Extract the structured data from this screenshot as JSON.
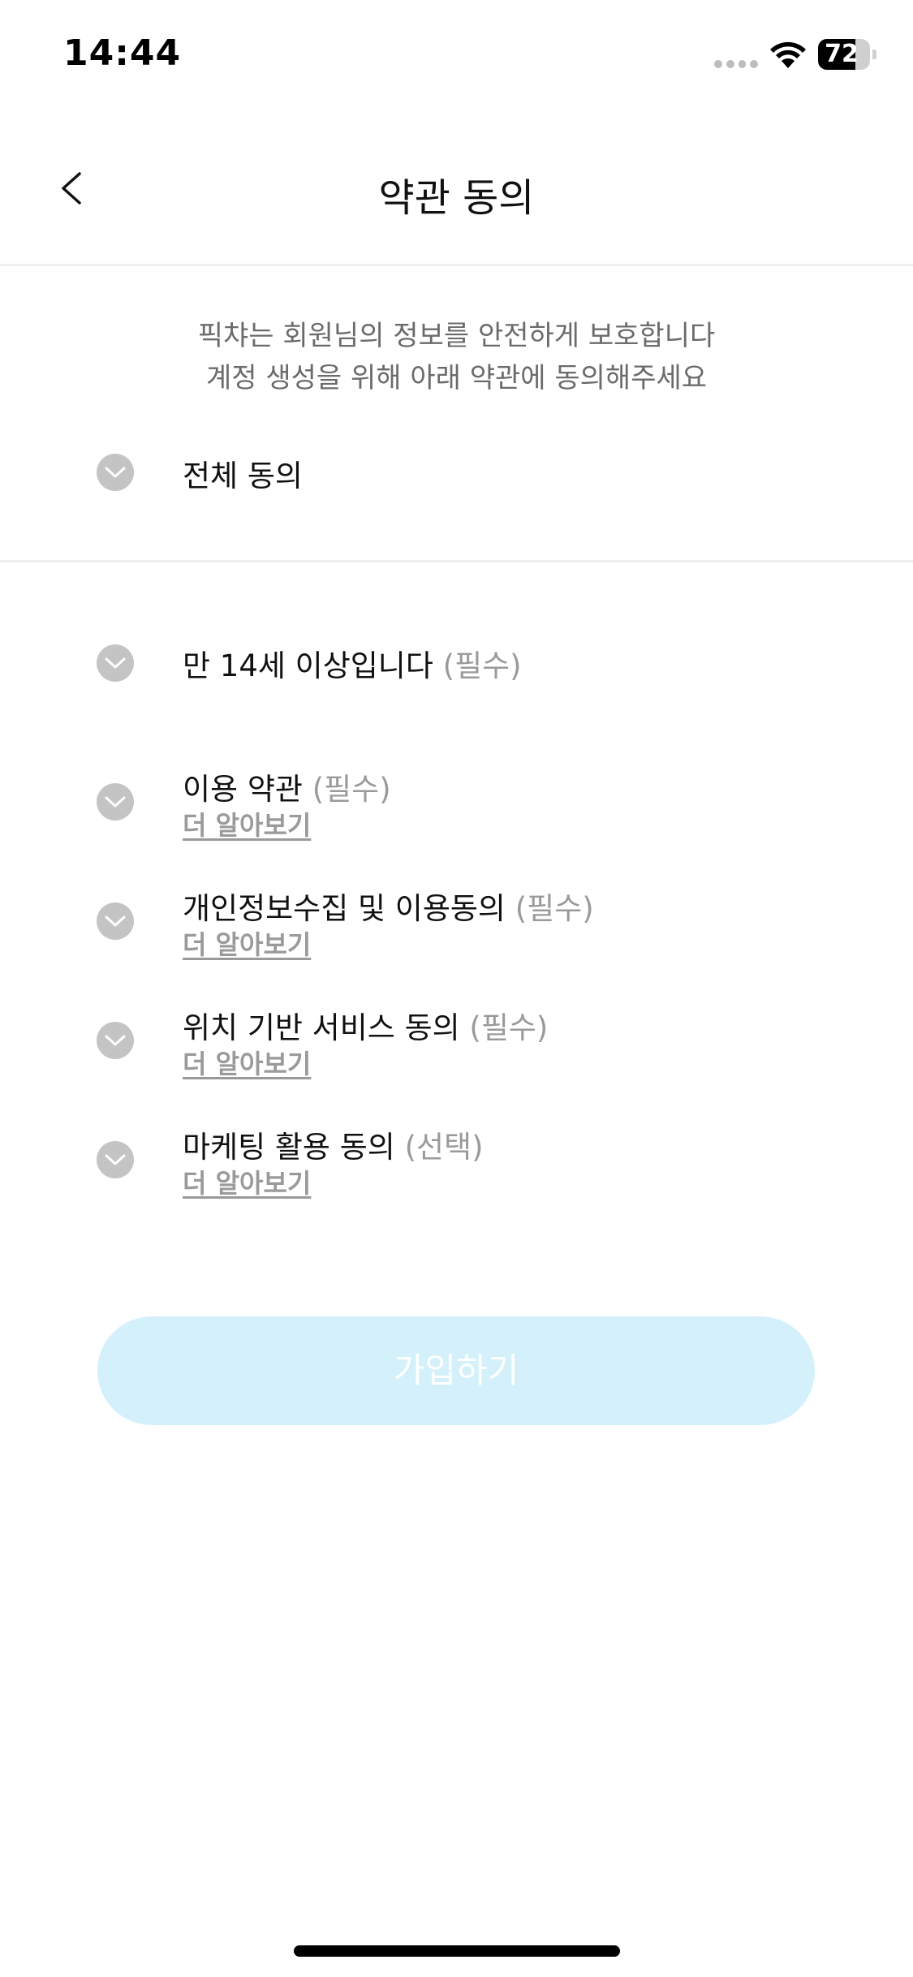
{
  "status_bar": {
    "time": "14:44",
    "battery": "72",
    "battery_level": 0.72,
    "icons": [
      "signal-dots-icon",
      "wifi-icon",
      "battery-icon"
    ]
  },
  "header": {
    "back_icon": "chevron-left-icon",
    "title": "약관 동의"
  },
  "intro": {
    "line1": "픽챠는 회원님의 정보를 안전하게 보호합니다",
    "line2": "계정 생성을 위해 아래 약관에 동의해주세요"
  },
  "agree_all": {
    "label": "전체 동의"
  },
  "items": [
    {
      "label": "만 14세 이상입니다",
      "tag": "(필수)",
      "link": ""
    },
    {
      "label": "이용 약관",
      "tag": "(필수)",
      "link": "더 알아보기"
    },
    {
      "label": "개인정보수집 및 이용동의",
      "tag": "(필수)",
      "link": "더 알아보기"
    },
    {
      "label": "위치 기반 서비스 동의",
      "tag": "(필수)",
      "link": "더 알아보기"
    },
    {
      "label": "마케팅 활용 동의",
      "tag": "(선택)",
      "link": "더 알아보기"
    }
  ],
  "signup_button": {
    "label": "가입하기",
    "enabled": false
  },
  "colors": {
    "check_inactive": "#c4c4c4",
    "button_disabled_bg": "#d4f1fb",
    "tag_text": "#9a9a9a"
  }
}
